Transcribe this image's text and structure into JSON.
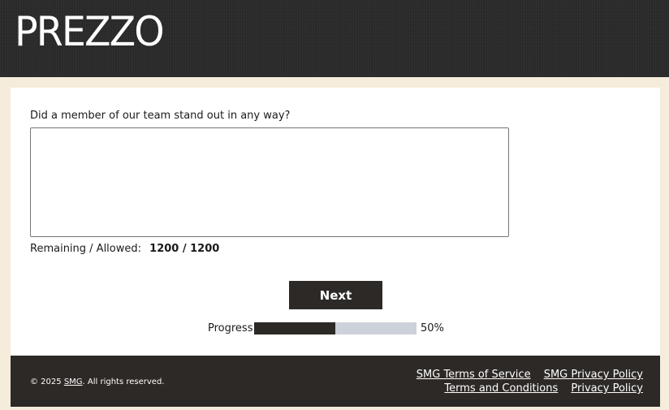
{
  "header": {
    "logo_text": "PREZZO",
    "background": "#2b2b2b"
  },
  "survey": {
    "question": "Did a member of our team stand out in any way?",
    "answer_value": "",
    "counter_label": "Remaining / Allowed:",
    "counter_value": "1200 / 1200",
    "next_label": "Next",
    "progress_label": "Progress",
    "progress_percent_text": "50%",
    "progress_fraction": 0.5
  },
  "footer": {
    "copyright_prefix": "© 2025 ",
    "copyright_link": "SMG",
    "copyright_suffix": ". All rights reserved.",
    "links_row1": [
      "SMG Terms of Service",
      "SMG Privacy Policy"
    ],
    "links_row2": [
      "Terms and Conditions",
      "Privacy Policy"
    ]
  },
  "colors": {
    "page_background": "#f6ecdc",
    "dark": "#2d2926",
    "progress_track": "#cdd1d9"
  }
}
